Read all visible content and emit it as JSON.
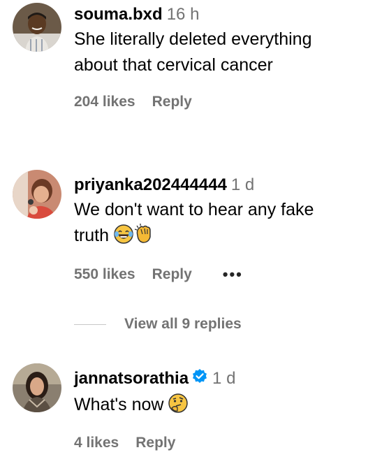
{
  "comments": [
    {
      "username": "souma.bxd",
      "time": "16 h",
      "text_lines": [
        "She literally deleted everything",
        "about that cervical cancer"
      ],
      "likes": "204 likes",
      "reply": "Reply"
    },
    {
      "username": "priyanka202444444",
      "time": "1 d",
      "text_lines": [
        "We don't want to hear any fake",
        "truth"
      ],
      "emojis": [
        "face-with-tears-of-joy",
        "clapping-hands"
      ],
      "likes": "550 likes",
      "reply": "Reply",
      "more_icon": "more-horizontal-icon"
    },
    {
      "username": "jannatsorathia",
      "verified": true,
      "time": "1 d",
      "text": "What's now",
      "emojis": [
        "thinking-face"
      ],
      "likes": "4 likes",
      "reply": "Reply"
    }
  ],
  "view_replies": "View all 9 replies",
  "colors": {
    "secondary_text": "#737373",
    "verified_blue": "#0095f6",
    "divider": "#c7c7c7"
  }
}
